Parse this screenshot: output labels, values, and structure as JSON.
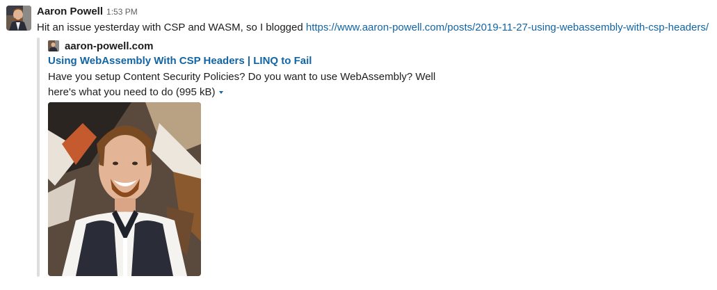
{
  "message": {
    "sender": "Aaron Powell",
    "timestamp": "1:53 PM",
    "text": "Hit an issue yesterday with CSP and WASM, so I blogged ",
    "link": "https://www.aaron-powell.com/posts/2019-11-27-using-webassembly-with-csp-headers/"
  },
  "attachment": {
    "service_name": "aaron-powell.com",
    "title": "Using WebAssembly With CSP Headers | LINQ to Fail",
    "description": "Have you setup Content Security Policies? Do you want to use WebAssembly? Well here's what you need to do",
    "size": "(995 kB)"
  },
  "colors": {
    "link": "#1264a3",
    "text": "#1d1c1d",
    "timestamp": "#616061",
    "attachment_bar": "#dddddd"
  }
}
